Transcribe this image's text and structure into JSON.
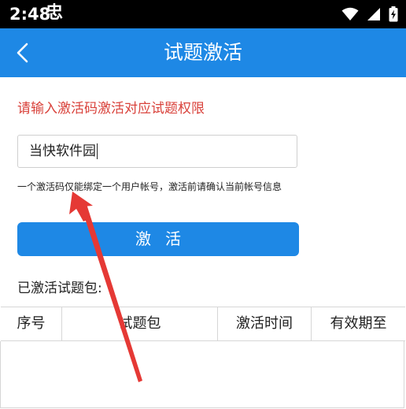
{
  "status_bar": {
    "time": "2:48",
    "notification_glyph": "忠",
    "icons": [
      "wifi-icon",
      "signal-icon",
      "battery-charging-icon"
    ]
  },
  "app_bar": {
    "title": "试题激活",
    "back_icon": "chevron-left-icon",
    "background": "#1e88e5"
  },
  "activation": {
    "instruction": "请输入激活码激活对应试题权限",
    "instruction_color": "#d9423b",
    "code_value": "当快软件园",
    "note": "一个激活码仅能绑定一个用户帐号，激活前请确认当前帐号信息",
    "button_label": "激活"
  },
  "activated": {
    "label": "已激活试题包:",
    "columns": [
      "序号",
      "试题包",
      "激活时间",
      "有效期至"
    ],
    "rows": []
  },
  "annotation": {
    "arrow_color": "#e53935"
  }
}
